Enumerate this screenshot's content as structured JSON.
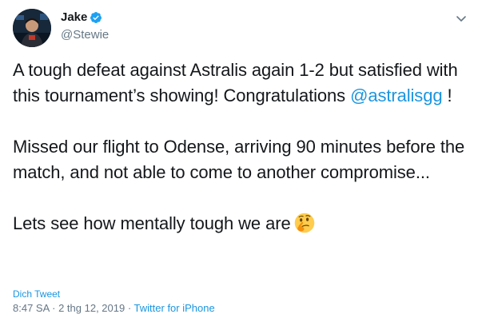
{
  "author": {
    "display_name": "Jake",
    "handle": "@Stewie",
    "verified": true,
    "avatar_icon": "profile-photo"
  },
  "tweet": {
    "paragraph1_text": "A tough defeat against Astralis again 1-2 but satisfied with this tournament’s showing! Congratulations ",
    "mention": "@astralisgg",
    "paragraph1_tail": " !",
    "paragraph2": "Missed our flight to Odense, arriving 90 minutes before the match, and not able to come to another compromise...",
    "paragraph3": "Lets see how mentally tough we are",
    "emoji": "thinking-face-icon"
  },
  "footer": {
    "translate_label": "Dich Tweet",
    "time_date": "8:47 SA · 2 thg 12, 2019 · ",
    "source": "Twitter for iPhone"
  },
  "colors": {
    "link": "#1b95e0",
    "secondary_text": "#657786",
    "primary_text": "#14171a",
    "verified_badge": "#1da1f2"
  }
}
